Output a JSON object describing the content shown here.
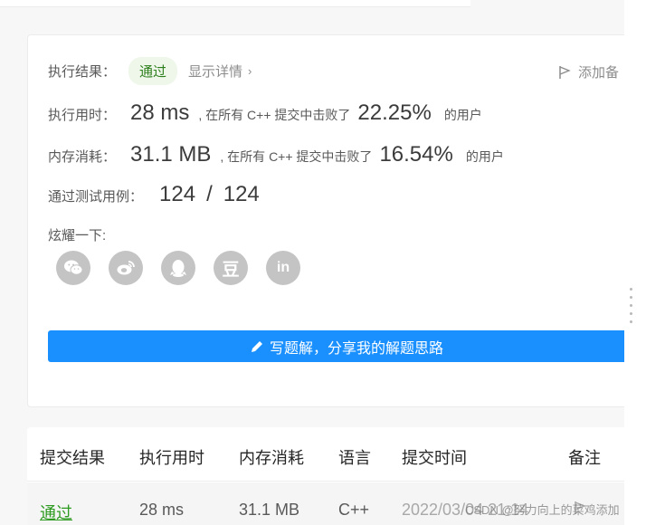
{
  "result": {
    "label": "执行结果：",
    "status": "通过",
    "details_link": "显示详情",
    "add_note": "添加备"
  },
  "runtime": {
    "label": "执行用时：",
    "value": "28 ms",
    "beat_prefix": ", 在所有 C++ 提交中击败了",
    "percent": "22.25",
    "suffix": "的用户"
  },
  "memory": {
    "label": "内存消耗：",
    "value": "31.1 MB",
    "beat_prefix": ", 在所有 C++ 提交中击败了",
    "percent": "16.54",
    "suffix": "的用户"
  },
  "testcases": {
    "label": "通过测试用例：",
    "passed": "124",
    "separator": "/",
    "total": "124"
  },
  "share": {
    "label": "炫耀一下:",
    "icons": [
      "wechat-icon",
      "weibo-icon",
      "qq-icon",
      "douban-icon",
      "linkedin-icon"
    ],
    "douban_glyph": "豆",
    "linkedin_glyph": "in"
  },
  "write_solution": {
    "label": "写题解，分享我的解题思路"
  },
  "table": {
    "headers": [
      "提交结果",
      "执行用时",
      "内存消耗",
      "语言",
      "提交时间",
      "备注"
    ],
    "rows": [
      {
        "status": "通过",
        "runtime": "28 ms",
        "memory": "31.1 MB",
        "language": "C++",
        "time": "2022/03/04 21:14"
      }
    ]
  },
  "watermark": "CSDN @努力向上的菜鸡添加",
  "colors": {
    "accent": "#1a90ff",
    "pass_green": "#2d9a20",
    "icon_gray": "#c4c4c4"
  }
}
